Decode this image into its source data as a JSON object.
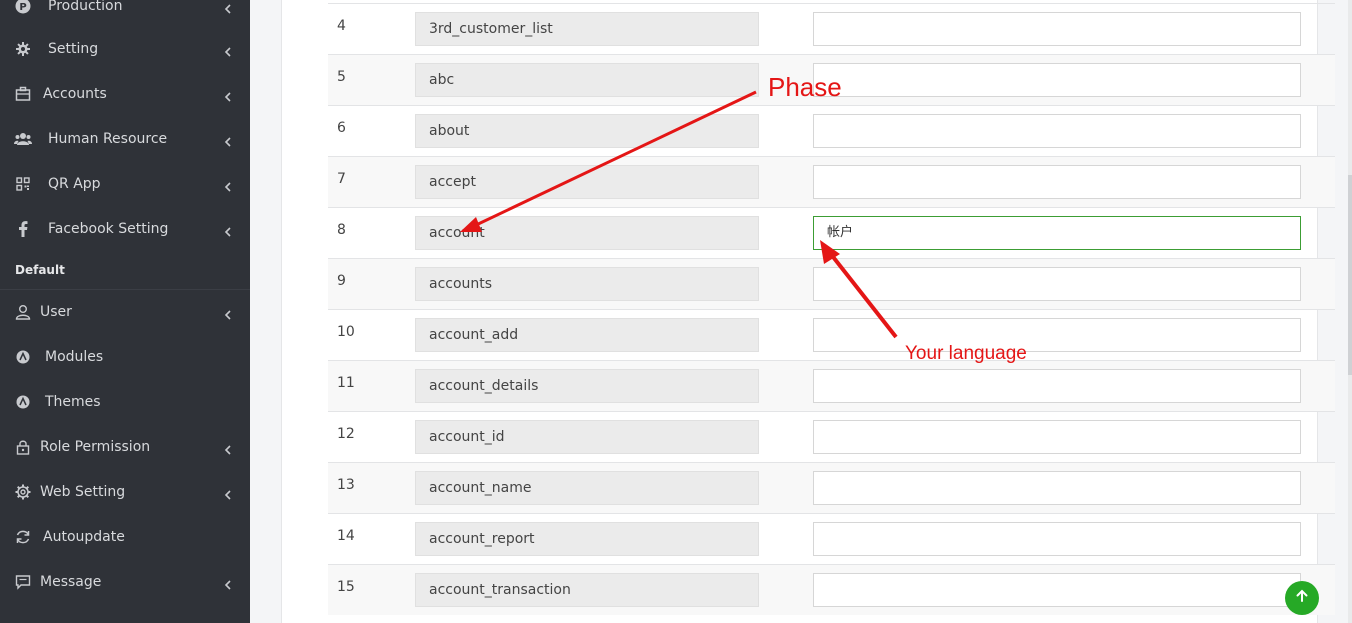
{
  "sidebar": {
    "items": [
      {
        "label": "Production",
        "icon": "p-circle-icon",
        "chevron": true
      },
      {
        "label": "Setting",
        "icon": "gear-icon",
        "chevron": true
      },
      {
        "label": "Accounts",
        "icon": "briefcase-icon",
        "chevron": true
      },
      {
        "label": "Human Resource",
        "icon": "users-icon",
        "chevron": true
      },
      {
        "label": "QR App",
        "icon": "qr-code-icon",
        "chevron": true
      },
      {
        "label": "Facebook Setting",
        "icon": "facebook-icon",
        "chevron": true
      }
    ],
    "section_label": "Default",
    "default_items": [
      {
        "label": "User",
        "icon": "user-icon",
        "chevron": true
      },
      {
        "label": "Modules",
        "icon": "circle-logo-icon",
        "chevron": false
      },
      {
        "label": "Themes",
        "icon": "circle-logo-icon",
        "chevron": false
      },
      {
        "label": "Role Permission",
        "icon": "lock-icon",
        "chevron": true
      },
      {
        "label": "Web Setting",
        "icon": "cog-icon",
        "chevron": true
      },
      {
        "label": "Autoupdate",
        "icon": "refresh-icon",
        "chevron": false
      },
      {
        "label": "Message",
        "icon": "message-icon",
        "chevron": true
      }
    ]
  },
  "table": {
    "rows": [
      {
        "num": "4",
        "phrase": "3rd_customer_list",
        "translation": ""
      },
      {
        "num": "5",
        "phrase": "abc",
        "translation": ""
      },
      {
        "num": "6",
        "phrase": "about",
        "translation": ""
      },
      {
        "num": "7",
        "phrase": "accept",
        "translation": ""
      },
      {
        "num": "8",
        "phrase": "account",
        "translation": "帐户"
      },
      {
        "num": "9",
        "phrase": "accounts",
        "translation": ""
      },
      {
        "num": "10",
        "phrase": "account_add",
        "translation": ""
      },
      {
        "num": "11",
        "phrase": "account_details",
        "translation": ""
      },
      {
        "num": "12",
        "phrase": "account_id",
        "translation": ""
      },
      {
        "num": "13",
        "phrase": "account_name",
        "translation": ""
      },
      {
        "num": "14",
        "phrase": "account_report",
        "translation": ""
      },
      {
        "num": "15",
        "phrase": "account_transaction",
        "translation": ""
      }
    ]
  },
  "annotations": {
    "phase": "Phase",
    "language": "Your language"
  },
  "colors": {
    "sidebar_bg": "#2f3238",
    "active_border": "#3c9d34",
    "annotation": "#e41616",
    "scroll_top_button": "#26a926"
  },
  "scroll_top": {
    "icon": "arrow-up-icon"
  }
}
